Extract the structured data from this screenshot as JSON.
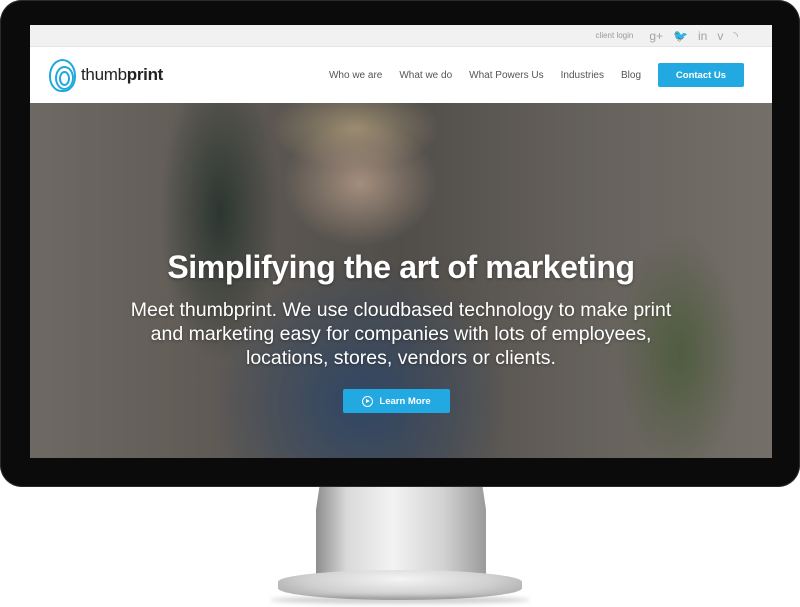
{
  "topbar": {
    "client_login": "client login",
    "social_icons": [
      {
        "name": "google-plus-icon",
        "glyph": "g+"
      },
      {
        "name": "twitter-icon",
        "glyph": "🐦"
      },
      {
        "name": "linkedin-icon",
        "glyph": "in"
      },
      {
        "name": "vimeo-icon",
        "glyph": "v"
      },
      {
        "name": "rss-icon",
        "glyph": "◝"
      }
    ]
  },
  "logo": {
    "text_light": "thumb",
    "text_bold": "print"
  },
  "nav": {
    "items": [
      "Who we are",
      "What we do",
      "What Powers Us",
      "Industries",
      "Blog"
    ],
    "contact_label": "Contact Us"
  },
  "hero": {
    "title": "Simplifying the art of marketing",
    "subtitle": "Meet thumbprint. We use cloudbased technology to make print and marketing easy for companies with lots of employees, locations, stores, vendors or clients.",
    "button_label": "Learn More"
  },
  "colors": {
    "accent": "#22a9e1"
  }
}
